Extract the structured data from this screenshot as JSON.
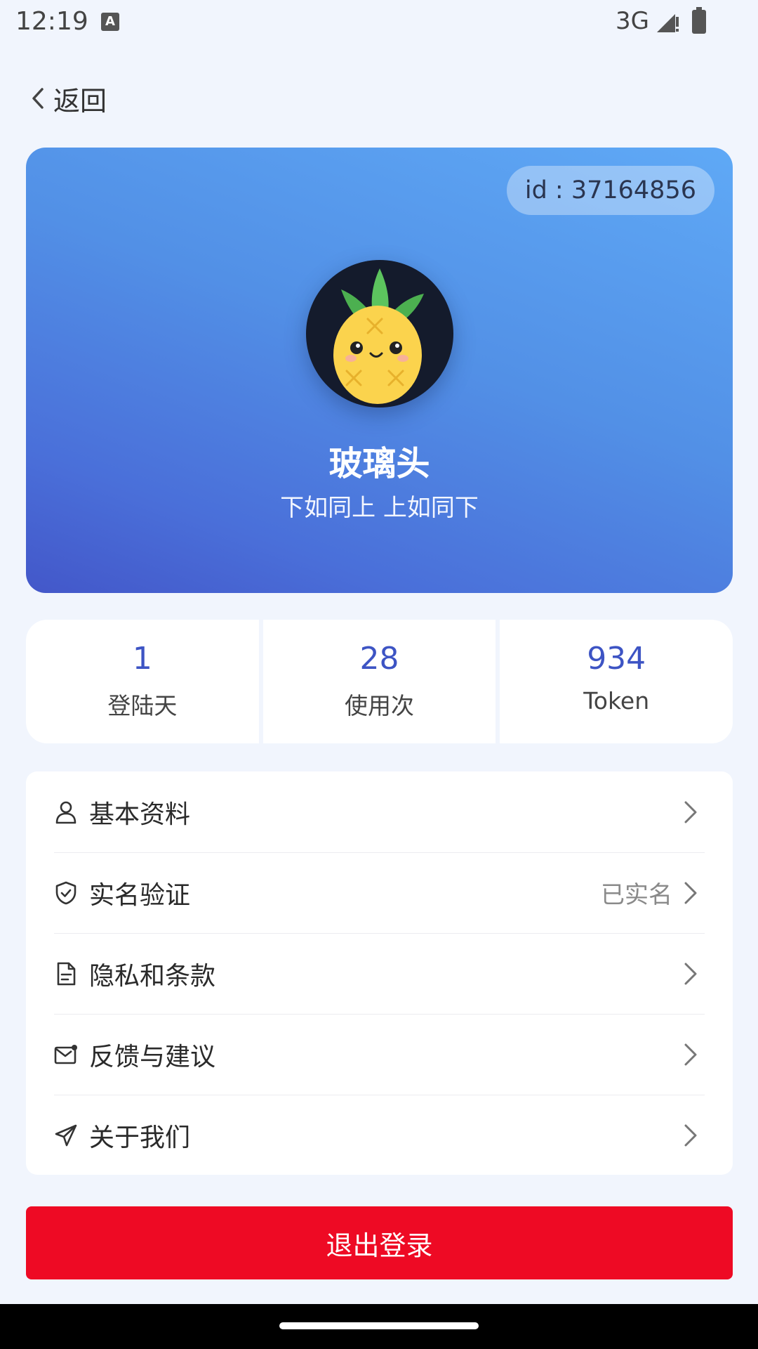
{
  "status_bar": {
    "time": "12:19",
    "app_icon_letter": "A",
    "network": "3G"
  },
  "header": {
    "back_label": "返回"
  },
  "profile": {
    "id_label": "id : 37164856",
    "avatar": "pineapple-avatar",
    "nickname": "玻璃头",
    "motto": "下如同上 上如同下"
  },
  "stats": [
    {
      "value": "1",
      "label": "登陆天"
    },
    {
      "value": "28",
      "label": "使用次"
    },
    {
      "value": "934",
      "label": "Token"
    }
  ],
  "menu": [
    {
      "icon": "user-icon",
      "label": "基本资料",
      "value": ""
    },
    {
      "icon": "shield-check-icon",
      "label": "实名验证",
      "value": "已实名"
    },
    {
      "icon": "document-icon",
      "label": "隐私和条款",
      "value": ""
    },
    {
      "icon": "mail-icon",
      "label": "反馈与建议",
      "value": ""
    },
    {
      "icon": "send-icon",
      "label": "关于我们",
      "value": ""
    }
  ],
  "logout_label": "退出登录",
  "colors": {
    "accent": "#3d54c4",
    "logout": "#ee0a24",
    "background": "#f1f5fd"
  }
}
